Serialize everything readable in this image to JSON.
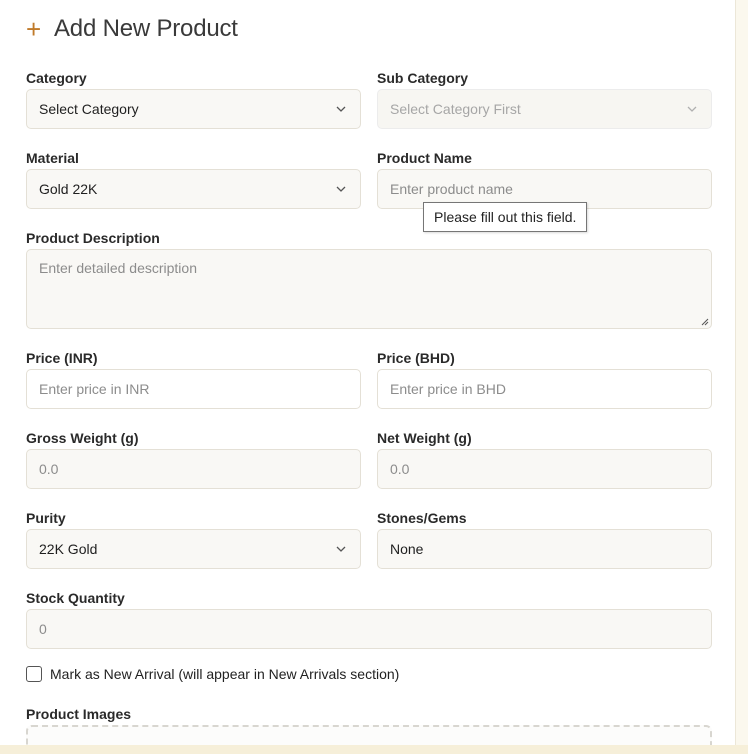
{
  "header": {
    "title": "Add New Product",
    "icon": "plus-icon"
  },
  "colors": {
    "accent": "#c07a2a",
    "field_bg": "#f9f8f5",
    "border": "#e4e0d6"
  },
  "form": {
    "category": {
      "label": "Category",
      "value": "Select Category"
    },
    "sub_category": {
      "label": "Sub Category",
      "value": "Select Category First"
    },
    "material": {
      "label": "Material",
      "value": "Gold 22K"
    },
    "product_name": {
      "label": "Product Name",
      "placeholder": "Enter product name"
    },
    "validation_tooltip": "Please fill out this field.",
    "description": {
      "label": "Product Description",
      "placeholder": "Enter detailed description"
    },
    "price_inr": {
      "label": "Price (INR)",
      "placeholder": "Enter price in INR"
    },
    "price_bhd": {
      "label": "Price (BHD)",
      "placeholder": "Enter price in BHD"
    },
    "gross_weight": {
      "label": "Gross Weight (g)",
      "placeholder": "0.0"
    },
    "net_weight": {
      "label": "Net Weight (g)",
      "placeholder": "0.0"
    },
    "purity": {
      "label": "Purity",
      "value": "22K Gold"
    },
    "stones": {
      "label": "Stones/Gems",
      "value": "None"
    },
    "stock_quantity": {
      "label": "Stock Quantity",
      "placeholder": "0"
    },
    "new_arrival": {
      "label": "Mark as New Arrival (will appear in New Arrivals section)",
      "checked": false
    },
    "images": {
      "label": "Product Images"
    }
  }
}
